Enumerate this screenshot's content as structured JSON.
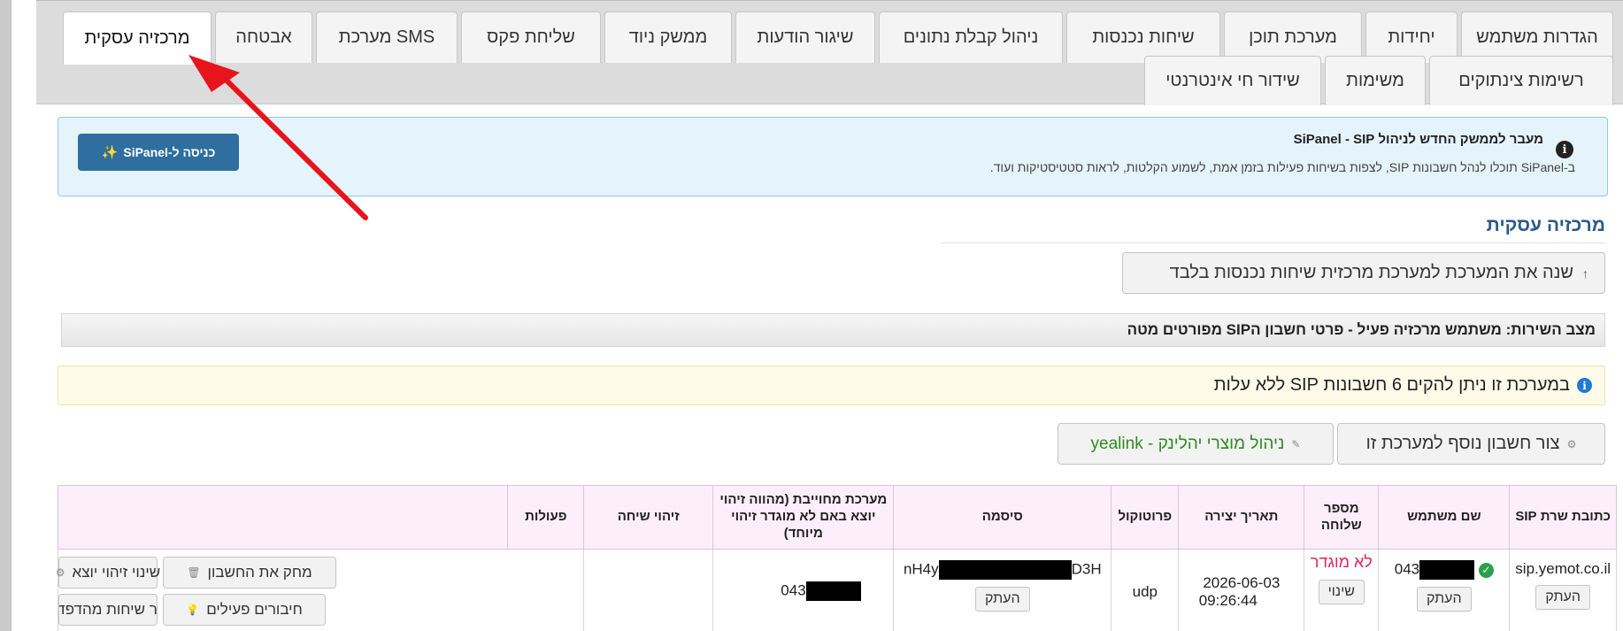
{
  "tabs_row1": [
    {
      "label": "הגדרות משתמש"
    },
    {
      "label": "יחידות"
    },
    {
      "label": "מערכת תוכן"
    },
    {
      "label": "שיחות נכנסות"
    },
    {
      "label": "ניהול קבלת נתונים"
    },
    {
      "label": "שיגור הודעות"
    },
    {
      "label": "ממשק ניוד"
    },
    {
      "label": "שליחת פקס"
    },
    {
      "label": "מערכת SMS"
    },
    {
      "label": "אבטחה"
    },
    {
      "label": "מרכזיה עסקית"
    }
  ],
  "tabs_row2": [
    {
      "label": "רשימות צינתוקים"
    },
    {
      "label": "משימות"
    },
    {
      "label": "שידור חי אינטרנטי"
    }
  ],
  "banner": {
    "title": "מעבר לממשק החדש לניהול SiPanel - SIP",
    "text": "ב-SiPanel תוכלו לנהל חשבונות SIP, לצפות בשיחות פעילות בזמן אמת, לשמוע הקלטות, לראות סטטיסטיקות ועוד.",
    "button_label": "כניסה ל-SiPanel",
    "button_icon": "sparkle-icon"
  },
  "section": {
    "title": "מרכזיה עסקית",
    "switch_label": "שנה את המערכת למערכת מרכזית שיחות נכנסות בלבד",
    "status": "מצב השירות: משתמש מרכזיה פעיל - פרטי חשבון הSIP מפורטים מטה",
    "notice": "במערכת זו ניתן להקים 6 חשבונות SIP ללא עלות",
    "add_account": "צור חשבון נוסף למערכת זו",
    "yealink": "ניהול מוצרי יהלינק - yealink"
  },
  "table": {
    "headers": [
      "כתובת שרת SIP",
      "שם משתמש",
      "מספר שלוחה",
      "תאריך יצירה",
      "פרוטוקול",
      "סיסמה",
      "מערכת מחוייבת (מהווה זיהוי יוצא באם לא מוגדר זיהוי מיוחד)",
      "זיהוי שיחה",
      "פעולות"
    ],
    "row": {
      "server": "sip.yemot.co.il",
      "copy": "העתק",
      "username_prefix": "043",
      "extension_status": "לא מוגדר",
      "change": "שינוי",
      "date": "2026-06-03",
      "time": "09:26:44",
      "protocol": "udp",
      "password_prefix": "nH4y",
      "password_suffix": "D3H",
      "billed_prefix": "043",
      "caller_id": ""
    },
    "actions": {
      "delete": "מחק את החשבון",
      "change_caller_id": "שינוי זיהוי יוצא",
      "active_connections": "חיבורים פעילים",
      "browser_calls": "אפשר שיחות מהדפדפן"
    }
  },
  "colors": {
    "accent_blue": "#2f6f9f",
    "title_blue": "#2a5a8a",
    "arrow_red": "#e8141b",
    "status_red": "#e0245e",
    "yealink_green": "#2e8b1f"
  }
}
